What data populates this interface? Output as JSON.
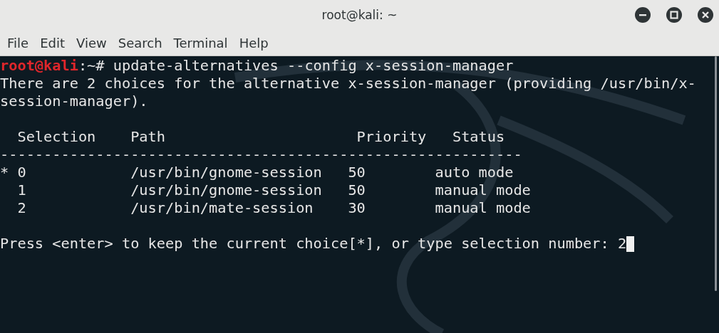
{
  "window": {
    "title": "root@kali: ~"
  },
  "menu": [
    "File",
    "Edit",
    "View",
    "Search",
    "Terminal",
    "Help"
  ],
  "terminal": {
    "lines": [
      {
        "kind": "prompt",
        "user_host": "root@kali",
        "path": ":~# ",
        "command": "update-alternatives --config x-session-manager"
      },
      {
        "kind": "text",
        "text": "There are 2 choices for the alternative x-session-manager (providing /usr/bin/x-"
      },
      {
        "kind": "text",
        "text": "session-manager)."
      },
      {
        "kind": "blank"
      },
      {
        "kind": "text",
        "text": "  Selection    Path                      Priority   Status"
      },
      {
        "kind": "text",
        "text": "------------------------------------------------------------"
      },
      {
        "kind": "text",
        "text": "* 0            /usr/bin/gnome-session   50        auto mode"
      },
      {
        "kind": "text",
        "text": "  1            /usr/bin/gnome-session   50        manual mode"
      },
      {
        "kind": "text",
        "text": "  2            /usr/bin/mate-session    30        manual mode"
      },
      {
        "kind": "blank"
      },
      {
        "kind": "input",
        "text": "Press <enter> to keep the current choice[*], or type selection number: 2",
        "cursor": true
      }
    ]
  }
}
